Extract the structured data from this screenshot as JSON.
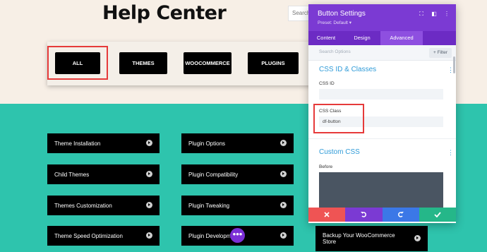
{
  "page": {
    "title": "Help Center",
    "search_placeholder": "Search"
  },
  "filters": [
    "ALL",
    "THEMES",
    "WOOCOMMERCE",
    "PLUGINS"
  ],
  "topics": {
    "col1": [
      "Theme Installation",
      "Child Themes",
      "Themes Customization",
      "Theme Speed Optimization"
    ],
    "col2": [
      "Plugin Options",
      "Plugin Compatibility",
      "Plugin Tweaking",
      "Plugin Developm"
    ],
    "col3": [
      "Backup Your WooCommerce Store"
    ]
  },
  "panel": {
    "title": "Button Settings",
    "preset": "Preset: Default ▾",
    "tabs": [
      "Content",
      "Design",
      "Advanced"
    ],
    "active_tab": "Advanced",
    "search_placeholder": "Search Options",
    "filter_label": "+ Filter",
    "section1_title": "CSS ID & Classes",
    "css_id_label": "CSS ID",
    "css_id_value": "",
    "css_class_label": "CSS Class",
    "css_class_value": "df-button",
    "section2_title": "Custom CSS",
    "before_label": "Before"
  },
  "footer": {
    "cancel_icon": "close-icon",
    "undo_icon": "undo-icon",
    "redo_icon": "redo-icon",
    "save_icon": "check-icon"
  },
  "colors": {
    "accent_purple": "#7b3ad3",
    "teal": "#2ec4ad",
    "highlight_red": "#e63a3a",
    "footer_red": "#ef5454",
    "footer_purple": "#7b3ad3",
    "footer_blue": "#3b78e7",
    "footer_green": "#25b789"
  }
}
